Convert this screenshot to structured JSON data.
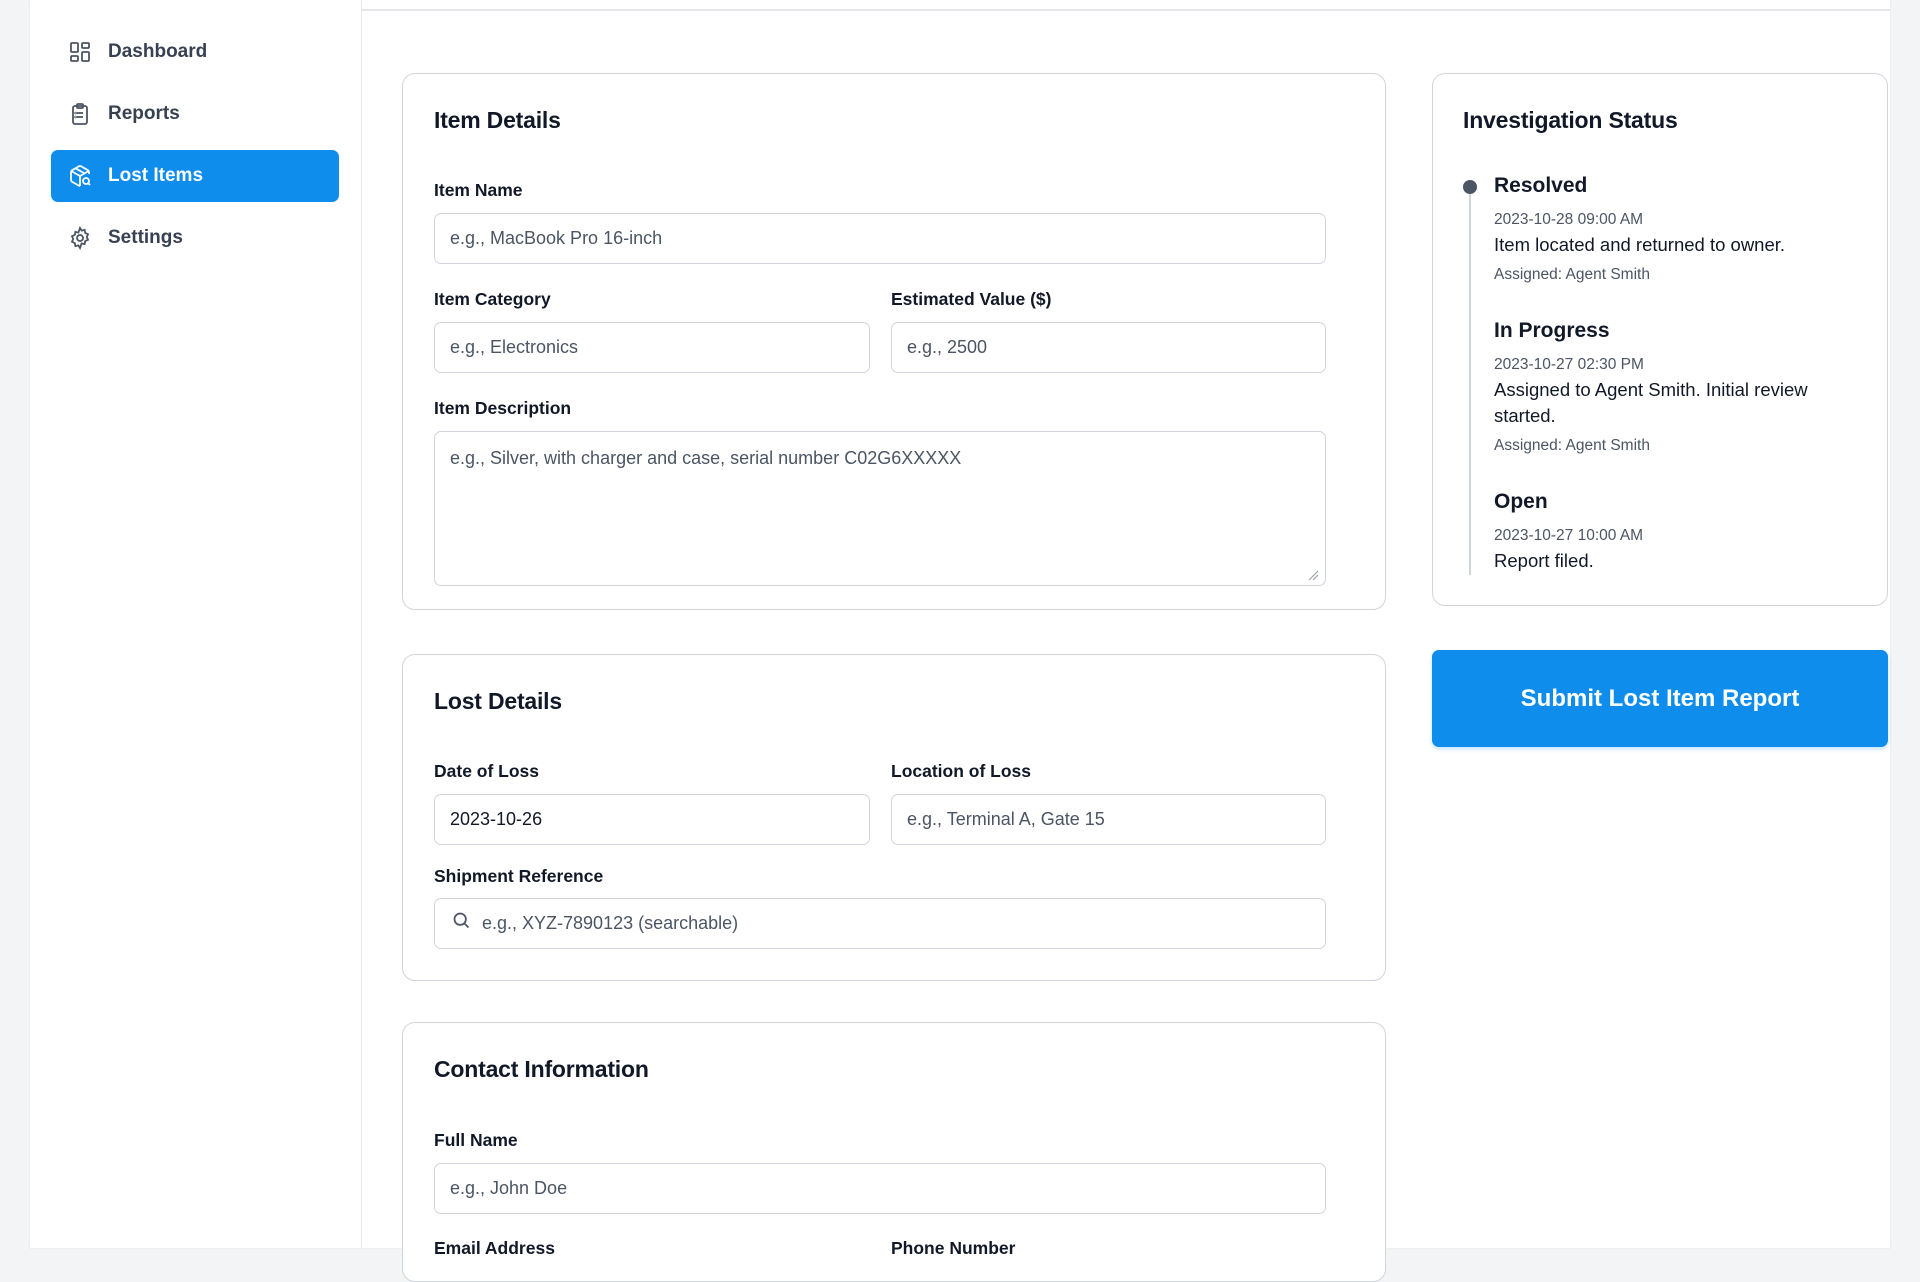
{
  "sidebar": {
    "items": [
      {
        "label": "Dashboard",
        "icon": "dashboard-icon"
      },
      {
        "label": "Reports",
        "icon": "clipboard-icon"
      },
      {
        "label": "Lost Items",
        "icon": "package-search-icon",
        "active": true
      },
      {
        "label": "Settings",
        "icon": "gear-icon"
      }
    ]
  },
  "item_details": {
    "title": "Item Details",
    "item_name_label": "Item Name",
    "item_name_placeholder": "e.g., MacBook Pro 16-inch",
    "item_category_label": "Item Category",
    "item_category_placeholder": "e.g., Electronics",
    "estimated_value_label": "Estimated Value ($)",
    "estimated_value_placeholder": "e.g., 2500",
    "description_label": "Item Description",
    "description_placeholder": "e.g., Silver, with charger and case, serial number C02G6XXXXX"
  },
  "lost_details": {
    "title": "Lost Details",
    "date_label": "Date of Loss",
    "date_value": "2023-10-26",
    "location_label": "Location of Loss",
    "location_placeholder": "e.g., Terminal A, Gate 15",
    "shipment_label": "Shipment Reference",
    "shipment_placeholder": "e.g., XYZ-7890123 (searchable)"
  },
  "contact": {
    "title": "Contact Information",
    "full_name_label": "Full Name",
    "full_name_placeholder": "e.g., John Doe",
    "email_label": "Email Address",
    "phone_label": "Phone Number"
  },
  "investigation": {
    "title": "Investigation Status",
    "entries": [
      {
        "status": "Resolved",
        "time": "2023-10-28 09:00 AM",
        "description": "Item located and returned to owner.",
        "assigned": "Assigned: Agent Smith"
      },
      {
        "status": "In Progress",
        "time": "2023-10-27 02:30 PM",
        "description": "Assigned to Agent Smith. Initial review started.",
        "assigned": "Assigned: Agent Smith"
      },
      {
        "status": "Open",
        "time": "2023-10-27 10:00 AM",
        "description": "Report filed."
      }
    ]
  },
  "submit_label": "Submit Lost Item Report",
  "colors": {
    "accent": "#0f8ded",
    "border": "#d1d5db",
    "text": "#111827",
    "muted": "#4b5563"
  }
}
